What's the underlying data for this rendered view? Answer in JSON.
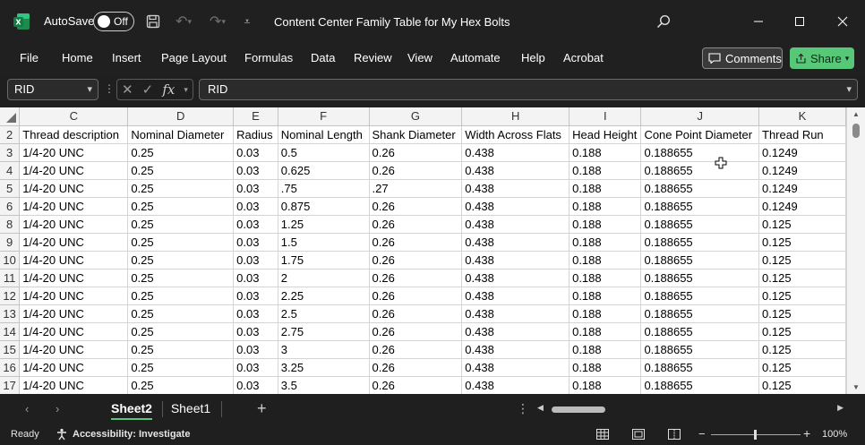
{
  "titlebar": {
    "autosave_label": "AutoSave",
    "autosave_state": "Off",
    "document_title": "Content Center Family Table for My Hex Bolts"
  },
  "ribbon": {
    "tabs": [
      "File",
      "Home",
      "Insert",
      "Page Layout",
      "Formulas",
      "Data",
      "Review",
      "View",
      "Automate",
      "Help",
      "Acrobat"
    ],
    "comments_label": "Comments",
    "share_label": "Share"
  },
  "formula_bar": {
    "name_box": "RID",
    "formula": "RID"
  },
  "grid": {
    "columns": [
      {
        "letter": "C",
        "header": "Thread description"
      },
      {
        "letter": "D",
        "header": "Nominal Diameter"
      },
      {
        "letter": "E",
        "header": "Radius"
      },
      {
        "letter": "F",
        "header": "Nominal Length"
      },
      {
        "letter": "G",
        "header": "Shank Diameter"
      },
      {
        "letter": "H",
        "header": "Width Across Flats"
      },
      {
        "letter": "I",
        "header": "Head Height"
      },
      {
        "letter": "J",
        "header": "Cone Point Diameter"
      },
      {
        "letter": "K",
        "header": "Thread Run"
      }
    ],
    "header_row_number": "2",
    "rows": [
      {
        "num": "3",
        "cells": [
          "1/4-20 UNC",
          "0.25",
          "0.03",
          "0.5",
          "0.26",
          "0.438",
          "0.188",
          "0.188655",
          "0.1249"
        ]
      },
      {
        "num": "4",
        "cells": [
          "1/4-20 UNC",
          "0.25",
          "0.03",
          "0.625",
          "0.26",
          "0.438",
          "0.188",
          "0.188655",
          "0.1249"
        ]
      },
      {
        "num": "5",
        "cells": [
          "1/4-20 UNC",
          "0.25",
          "0.03",
          ".75",
          ".27",
          "0.438",
          "0.188",
          "0.188655",
          "0.1249"
        ]
      },
      {
        "num": "6",
        "cells": [
          "1/4-20 UNC",
          "0.25",
          "0.03",
          "0.875",
          "0.26",
          "0.438",
          "0.188",
          "0.188655",
          "0.1249"
        ]
      },
      {
        "num": "8",
        "cells": [
          "1/4-20 UNC",
          "0.25",
          "0.03",
          "1.25",
          "0.26",
          "0.438",
          "0.188",
          "0.188655",
          "0.125"
        ]
      },
      {
        "num": "9",
        "cells": [
          "1/4-20 UNC",
          "0.25",
          "0.03",
          "1.5",
          "0.26",
          "0.438",
          "0.188",
          "0.188655",
          "0.125"
        ]
      },
      {
        "num": "10",
        "cells": [
          "1/4-20 UNC",
          "0.25",
          "0.03",
          "1.75",
          "0.26",
          "0.438",
          "0.188",
          "0.188655",
          "0.125"
        ]
      },
      {
        "num": "11",
        "cells": [
          "1/4-20 UNC",
          "0.25",
          "0.03",
          "2",
          "0.26",
          "0.438",
          "0.188",
          "0.188655",
          "0.125"
        ]
      },
      {
        "num": "12",
        "cells": [
          "1/4-20 UNC",
          "0.25",
          "0.03",
          "2.25",
          "0.26",
          "0.438",
          "0.188",
          "0.188655",
          "0.125"
        ]
      },
      {
        "num": "13",
        "cells": [
          "1/4-20 UNC",
          "0.25",
          "0.03",
          "2.5",
          "0.26",
          "0.438",
          "0.188",
          "0.188655",
          "0.125"
        ]
      },
      {
        "num": "14",
        "cells": [
          "1/4-20 UNC",
          "0.25",
          "0.03",
          "2.75",
          "0.26",
          "0.438",
          "0.188",
          "0.188655",
          "0.125"
        ]
      },
      {
        "num": "15",
        "cells": [
          "1/4-20 UNC",
          "0.25",
          "0.03",
          "3",
          "0.26",
          "0.438",
          "0.188",
          "0.188655",
          "0.125"
        ]
      },
      {
        "num": "16",
        "cells": [
          "1/4-20 UNC",
          "0.25",
          "0.03",
          "3.25",
          "0.26",
          "0.438",
          "0.188",
          "0.188655",
          "0.125"
        ]
      },
      {
        "num": "17",
        "cells": [
          "1/4-20 UNC",
          "0.25",
          "0.03",
          "3.5",
          "0.26",
          "0.438",
          "0.188",
          "0.188655",
          "0.125"
        ]
      }
    ]
  },
  "sheets": {
    "tabs": [
      "Sheet2",
      "Sheet1"
    ],
    "active": "Sheet2"
  },
  "statusbar": {
    "ready": "Ready",
    "accessibility": "Accessibility: Investigate",
    "zoom": "100%"
  },
  "colors": {
    "accent_green": "#57c878",
    "chrome_bg": "#202020",
    "grid_header_bg": "#f3f3f3"
  }
}
